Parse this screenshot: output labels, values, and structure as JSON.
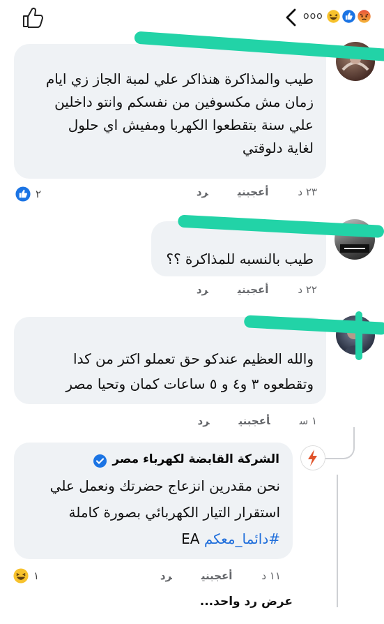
{
  "header": {
    "more_label": "ooo",
    "icons": [
      "back-chevron-icon",
      "haha-reaction-icon",
      "like-reaction-icon",
      "angry-reaction-icon",
      "like-outline-icon"
    ]
  },
  "comments": [
    {
      "author_visible_fragment": "",
      "text_lines": [
        "طيب والمذاكرة هنذاكر علي لمبة الجاز زي ايام",
        "زمان مش مكسوفين من نفسكم وانتو داخلين",
        "علي سنة بتقطعوا الكهربا ومفيش اي حلول",
        "لغاية دلوقتي"
      ],
      "time": "٢٣ د",
      "like_label": "أعجبني",
      "reply_label": "رد",
      "reaction_count": "٢",
      "reaction_icon": "like-reaction-icon"
    },
    {
      "author_visible_fragment": "",
      "text_lines": [
        "طيب بالنسبه للمذاكرة ؟؟"
      ],
      "time": "٢٢ د",
      "like_label": "أعجبني",
      "reply_label": "رد"
    },
    {
      "author_visible_fragment": "",
      "text_lines": [
        "والله العظيم عندكو حق تعملو اكتر من كدا",
        "وتقطعوه ٣ و٤ و ٥ ساعات كمان وتحيا مصر"
      ],
      "time": "١ س",
      "like_label": "أعجبني",
      "reply_label": "رد"
    }
  ],
  "reply": {
    "author": "الشركة القابضة لكهرباء مصر",
    "verified": true,
    "text_lines": [
      "نحن مقدرين انزعاج حضرتك ونعمل علي",
      "استقرار التيار الكهربائي بصورة كاملة"
    ],
    "hashtag": "#دائما_معكم",
    "sign": "EA",
    "time": "١١ د",
    "like_label": "أعجبني",
    "reply_label": "رد",
    "reaction_count": "١",
    "reaction_icon": "haha-reaction-icon"
  },
  "view_more_replies": "عرض رد واحد...",
  "colors": {
    "bubble": "#eff2f5",
    "meta_text": "#65676b",
    "like_blue": "#1b74e4",
    "hashtag": "#216fdb",
    "redaction_marker": "#22d3a7"
  }
}
